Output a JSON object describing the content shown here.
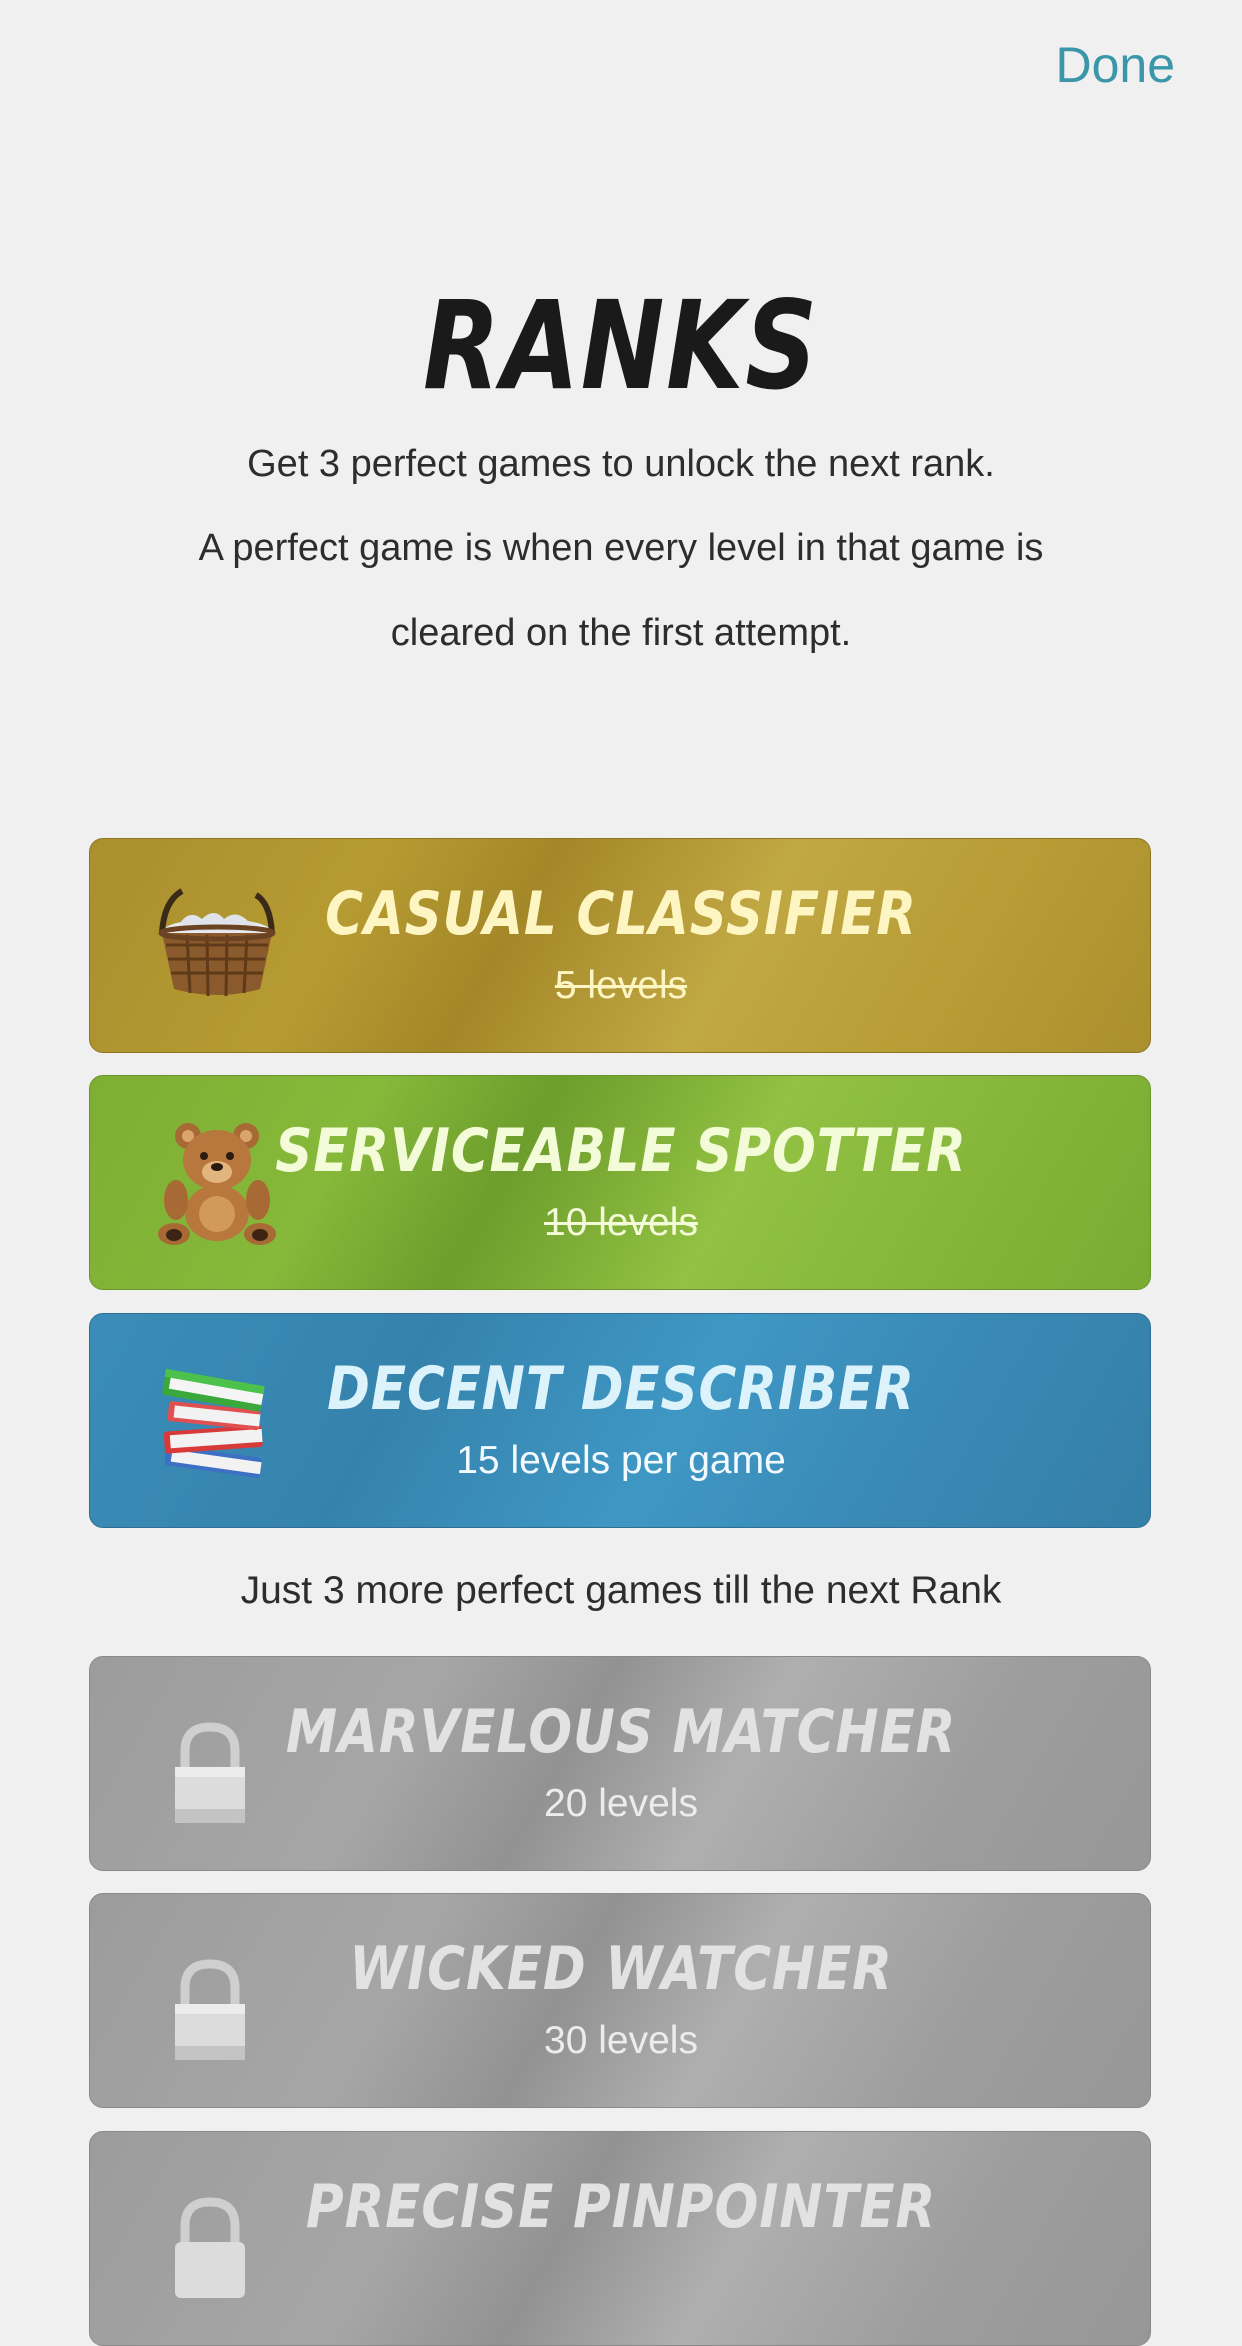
{
  "header": {
    "done_label": "Done"
  },
  "page": {
    "title": "RANKS",
    "intro_line1": "Get 3 perfect games to unlock the next rank.",
    "intro_line2": "A perfect game is when every level in that game is",
    "intro_line3": "cleared on the first attempt."
  },
  "ranks": [
    {
      "name": "Casual Classifier",
      "levels": "5 levels",
      "status": "completed",
      "icon": "basket-icon",
      "color": "#b39a36"
    },
    {
      "name": "Serviceable Spotter",
      "levels": "10 levels",
      "status": "completed",
      "icon": "teddy-bear-icon",
      "color": "#86b83a"
    },
    {
      "name": "Decent Describer",
      "levels": "15 levels per game",
      "status": "current",
      "icon": "books-icon",
      "color": "#3a8db8"
    },
    {
      "name": "Marvelous Matcher",
      "levels": "20 levels",
      "status": "locked",
      "icon": "lock-icon",
      "color": "#a0a0a0"
    },
    {
      "name": "Wicked Watcher",
      "levels": "30 levels",
      "status": "locked",
      "icon": "lock-icon",
      "color": "#a0a0a0"
    },
    {
      "name": "Precise Pinpointer",
      "levels": "",
      "status": "locked",
      "icon": "lock-icon",
      "color": "#a0a0a0"
    }
  ],
  "progress_note": "Just 3 more perfect games till the next Rank",
  "colors": {
    "accent": "#3a96a8",
    "background": "#f0f0f0"
  }
}
